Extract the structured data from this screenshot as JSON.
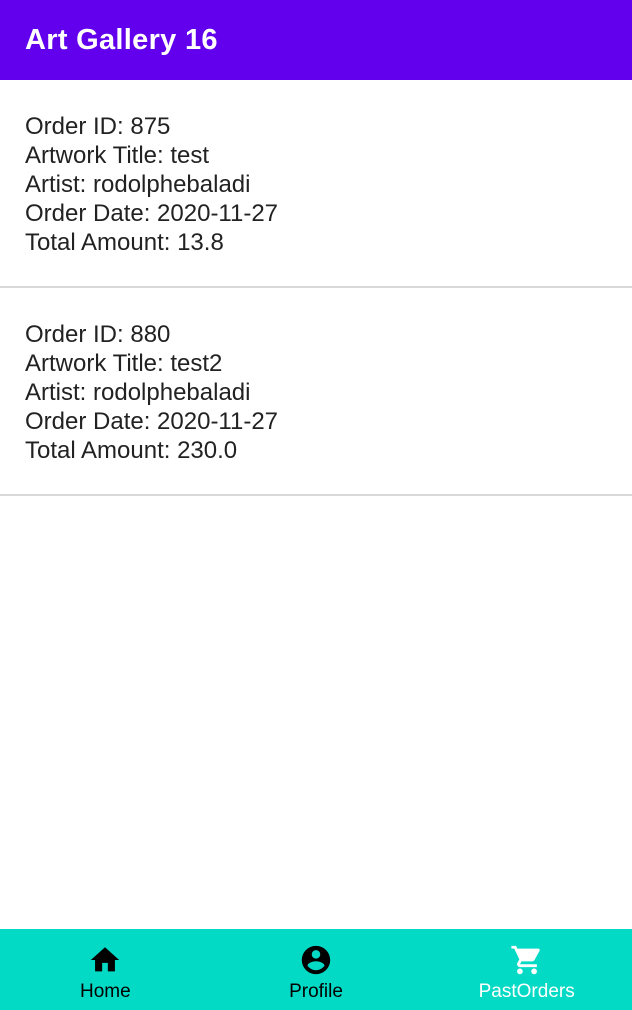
{
  "app_bar": {
    "title": "Art Gallery 16"
  },
  "orders": [
    {
      "order_id_line": "Order ID: 875",
      "title_line": "Artwork Title: test",
      "artist_line": "Artist: rodolphebaladi",
      "date_line": "Order Date: 2020-11-27",
      "amount_line": "Total Amount: 13.8"
    },
    {
      "order_id_line": "Order ID: 880",
      "title_line": "Artwork Title: test2",
      "artist_line": "Artist: rodolphebaladi",
      "date_line": "Order Date: 2020-11-27",
      "amount_line": "Total Amount: 230.0"
    }
  ],
  "bottom_nav": {
    "items": [
      {
        "label": "Home",
        "icon": "home-icon",
        "selected": false
      },
      {
        "label": "Profile",
        "icon": "account-circle-icon",
        "selected": false
      },
      {
        "label": "PastOrders",
        "icon": "shopping-cart-icon",
        "selected": true
      }
    ]
  },
  "colors": {
    "app_bar": "#6200ee",
    "bottom_nav": "#03dac5",
    "nav_inactive": "#000000",
    "nav_active": "#ffffff",
    "divider": "#d9d9d9"
  }
}
